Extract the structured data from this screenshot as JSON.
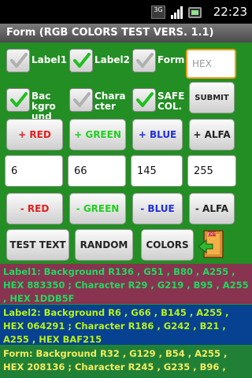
{
  "status_bar": {
    "time": "22:23",
    "network_label": "3G",
    "icons": [
      "network-3g-icon",
      "signal-icon",
      "battery-icon"
    ]
  },
  "title_bar": {
    "title": "Form (RGB COLORS TEST VERS. 1.1)"
  },
  "checkboxes_row1": [
    {
      "label": "Label1",
      "checked": false
    },
    {
      "label": "Label2",
      "checked": true
    },
    {
      "label": "Form",
      "checked": false
    }
  ],
  "hex_input": {
    "placeholder": "HEX",
    "value": ""
  },
  "checkboxes_row2": [
    {
      "label": "Background",
      "checked": true
    },
    {
      "label": "Character",
      "checked": false
    },
    {
      "label": "SAFE COL.",
      "checked": true
    }
  ],
  "submit_button": {
    "label": "SUBMIT"
  },
  "plus_buttons": [
    {
      "label": "+ RED",
      "color": "#e02020"
    },
    {
      "label": "+ GREEN",
      "color": "#20d020"
    },
    {
      "label": "+ BLUE",
      "color": "#2030d8"
    },
    {
      "label": "+ ALFA",
      "color": "#222222"
    }
  ],
  "value_fields": [
    "6",
    "66",
    "145",
    "255"
  ],
  "minus_buttons": [
    {
      "label": "- RED",
      "color": "#e02020"
    },
    {
      "label": "- GREEN",
      "color": "#20d020"
    },
    {
      "label": "- BLUE",
      "color": "#2030d8"
    },
    {
      "label": "- ALFA",
      "color": "#222222"
    }
  ],
  "action_buttons": [
    {
      "label": "TEST TEXT"
    },
    {
      "label": "RANDOM"
    },
    {
      "label": "COLORS"
    }
  ],
  "info_blocks": [
    {
      "text": "Label1: Background R136 , G51 , B80 , A255 , HEX 883350 ; Character R29 , G219 , B95 , A255 , HEX 1DDB5F",
      "background": "#883350",
      "text_color": "#1ddb5f"
    },
    {
      "text": "Label2: Background R6 , G66 , B145 , A255 , HEX 064291 ; Character R186 , G242 , B21 , A255 , HEX BAF215",
      "background": "#064291",
      "text_color": "#baf215"
    },
    {
      "text": "Form: Background R32 , G129 , B54 , A255 , HEX 208136 ; Character R245 , G235 , B96 ,",
      "background": "#208136",
      "text_color": "#f5eb60"
    }
  ],
  "colors": {
    "accent_orange": "#f39b1e",
    "check_green": "#1ec01e",
    "check_gray": "#b0b0b0"
  }
}
